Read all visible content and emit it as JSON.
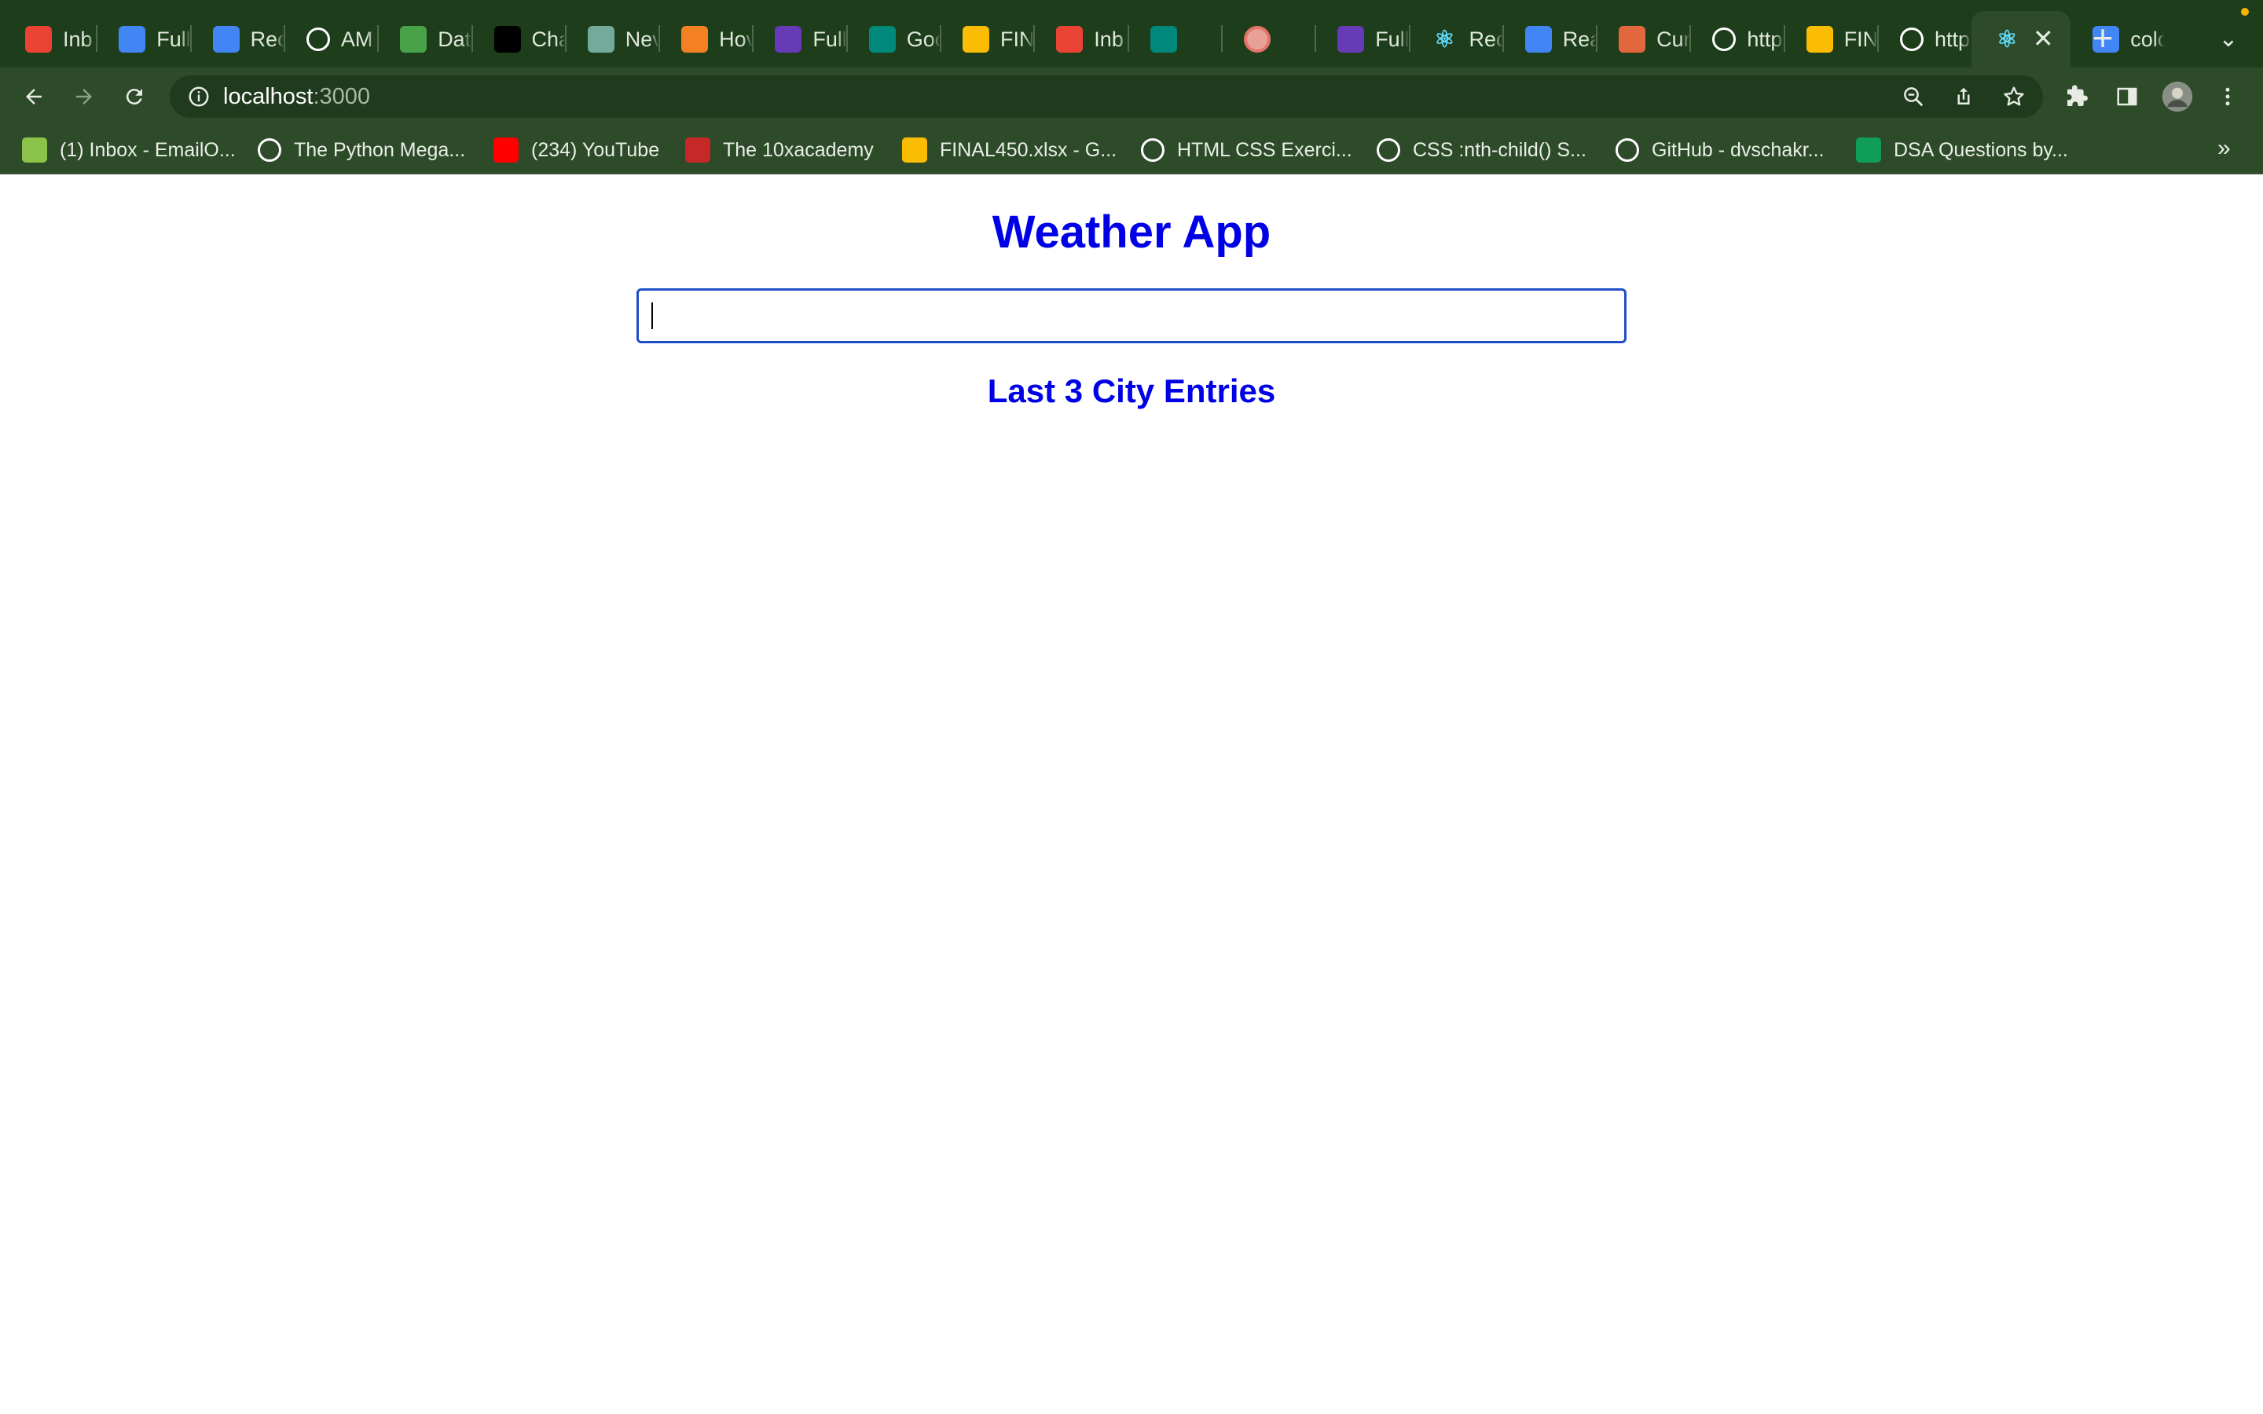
{
  "browser": {
    "tabs": [
      {
        "title": "Inb",
        "icon": "gmail-icon",
        "color": "#ea4335"
      },
      {
        "title": "Full",
        "icon": "google-docs-icon",
        "color": "#4285f4"
      },
      {
        "title": "Rec",
        "icon": "google-docs-icon",
        "color": "#4285f4"
      },
      {
        "title": "AM",
        "icon": "github-icon",
        "color": "#ffffff"
      },
      {
        "title": "Dat",
        "icon": "mongodb-icon",
        "color": "#47a248"
      },
      {
        "title": "Cha",
        "icon": "chatgpt-icon",
        "color": "#000000"
      },
      {
        "title": "Nev",
        "icon": "openai-icon",
        "color": "#74aa9c"
      },
      {
        "title": "Hov",
        "icon": "stackoverflow-icon",
        "color": "#f48024"
      },
      {
        "title": "Full",
        "icon": "google-forms-icon",
        "color": "#673ab7"
      },
      {
        "title": "Goo",
        "icon": "google-meet-icon",
        "color": "#00897b"
      },
      {
        "title": "FIN",
        "icon": "google-drive-icon",
        "color": "#fbbc04"
      },
      {
        "title": "Inb",
        "icon": "gmail-icon",
        "color": "#ea4335"
      },
      {
        "title": "",
        "icon": "google-meet-icon",
        "color": "#00897b"
      },
      {
        "title": "",
        "icon": "record-icon",
        "color": "#e57368"
      },
      {
        "title": "Full",
        "icon": "google-forms-icon",
        "color": "#673ab7"
      },
      {
        "title": "Rec",
        "icon": "react-icon",
        "color": "#61dafb"
      },
      {
        "title": "Rea",
        "icon": "google-docs-icon",
        "color": "#4285f4"
      },
      {
        "title": "Cur",
        "icon": "helmet-icon",
        "color": "#e2673f"
      },
      {
        "title": "http",
        "icon": "globe-icon",
        "color": "#ffffff"
      },
      {
        "title": "FIN",
        "icon": "google-drive-icon",
        "color": "#fbbc04"
      },
      {
        "title": "http",
        "icon": "globe-icon",
        "color": "#ffffff"
      },
      {
        "title": "",
        "icon": "react-icon",
        "color": "#61dafb"
      },
      {
        "title": "colo",
        "icon": "google-icon",
        "color": "#4285f4"
      }
    ],
    "active_tab_index": 21,
    "new_tab_label": "+",
    "address": {
      "host": "localhost",
      "port": ":3000"
    },
    "bookmarks": [
      {
        "label": "(1) Inbox - EmailO...",
        "icon": "emailoctopus-icon",
        "color": "#8bc34a"
      },
      {
        "label": "The Python Mega...",
        "icon": "udemy-icon",
        "color": "#ffffff"
      },
      {
        "label": "(234) YouTube",
        "icon": "youtube-icon",
        "color": "#ff0000"
      },
      {
        "label": "The 10xacademy",
        "icon": "10x-icon",
        "color": "#c62828"
      },
      {
        "label": "FINAL450.xlsx - G...",
        "icon": "google-drive-icon",
        "color": "#fbbc04"
      },
      {
        "label": "HTML CSS Exerci...",
        "icon": "w3schools-icon",
        "color": "#ffffff"
      },
      {
        "label": "CSS :nth-child() S...",
        "icon": "globe-icon",
        "color": "#ffffff"
      },
      {
        "label": "GitHub - dvschakr...",
        "icon": "github-icon",
        "color": "#ffffff"
      },
      {
        "label": "DSA Questions by...",
        "icon": "google-sheets-icon",
        "color": "#0f9d58"
      }
    ],
    "bookmarks_overflow": "»"
  },
  "app": {
    "title": "Weather App",
    "search": {
      "value": "",
      "placeholder": ""
    },
    "recent_heading": "Last 3 City Entries",
    "accent_color": "#0000e6"
  }
}
